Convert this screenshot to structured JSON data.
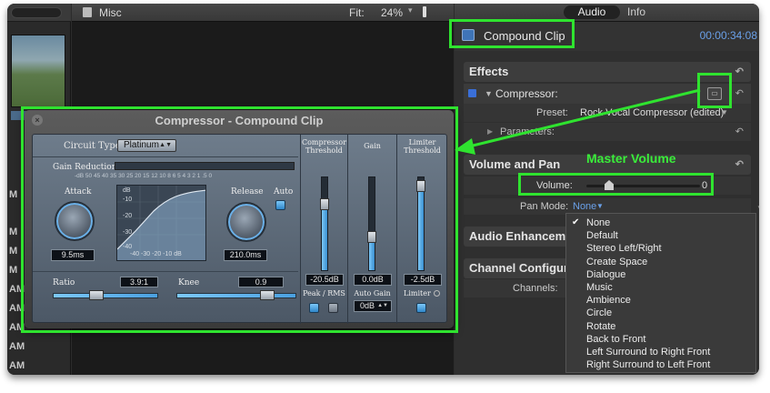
{
  "browser": {
    "letters": [
      "M",
      "M",
      "M",
      "M",
      "AM",
      "AM",
      "AM",
      "AM",
      "AM"
    ]
  },
  "viewer": {
    "title": "Misc",
    "fit_label": "Fit:",
    "fit_value": "24%"
  },
  "inspector": {
    "tabs": {
      "audio": "Audio",
      "info": "Info"
    },
    "clip_name": "Compound Clip",
    "timecode": "00:00:34:08",
    "effects": {
      "header": "Effects",
      "compressor_label": "Compressor:",
      "preset_label": "Preset:",
      "preset_value": "Rock Vocal Compressor (edited)",
      "parameters_label": "Parameters:"
    },
    "volume_and_pan": {
      "header": "Volume and Pan",
      "volume_label": "Volume:",
      "volume_value": "0",
      "pan_mode_label": "Pan Mode:",
      "pan_mode_value": "None"
    },
    "audio_enhancements": {
      "header": "Audio Enhancements"
    },
    "channel_configuration": {
      "header": "Channel Configuration",
      "channels_label": "Channels:"
    }
  },
  "pan_menu": {
    "selected": "None",
    "items": [
      "None",
      "Default",
      "Stereo Left/Right",
      "Create Space",
      "Dialogue",
      "Music",
      "Ambience",
      "Circle",
      "Rotate",
      "Back to Front",
      "Left Surround to Right Front",
      "Right Surround to Left Front"
    ]
  },
  "compressor": {
    "window_title": "Compressor - Compound Clip",
    "circuit_type_label": "Circuit Type",
    "circuit_type_value": "Platinum",
    "gain_reduction_label": "Gain Reduction",
    "gain_reduction_scale": "-dB  50 45 40 35 30 25 20 15 12 10  8   6   5   4   3   2   1  .5   0",
    "attack_label": "Attack",
    "attack_value": "9.5ms",
    "release_label": "Release",
    "release_value": "210.0ms",
    "auto_label": "Auto",
    "graph": {
      "db_label": "dB",
      "y_labels": [
        "-10",
        "-20",
        "-30",
        "-40"
      ],
      "x_labels": "-40 -30 -20 -10  dB"
    },
    "ratio_label": "Ratio",
    "ratio_value": "3.9:1",
    "knee_label": "Knee",
    "knee_value": "0.9",
    "compressor_threshold_label": "Compressor Threshold",
    "compressor_threshold_value": "-20.5dB",
    "gain_label": "Gain",
    "gain_value": "0.0dB",
    "limiter_threshold_label": "Limiter Threshold",
    "limiter_threshold_value": "-2.5dB",
    "peak_rms_label": "Peak / RMS",
    "auto_gain_label": "Auto Gain",
    "auto_gain_value": "0dB",
    "limiter_label": "Limiter"
  },
  "annotation": {
    "master_volume_label": "Master Volume"
  },
  "colors": {
    "highlight": "#2fe32f",
    "accent_blue": "#6aa0e8"
  }
}
